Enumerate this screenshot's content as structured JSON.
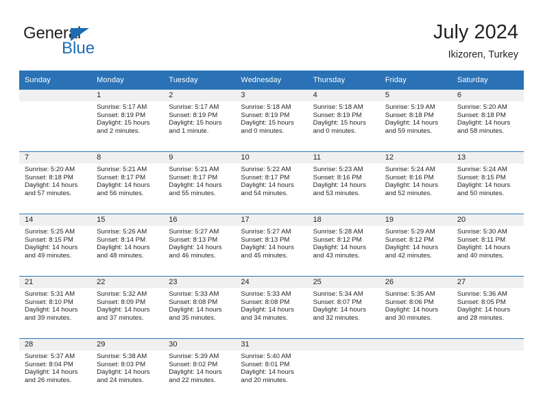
{
  "brand": {
    "name_part1": "General",
    "name_part2": "Blue",
    "accent_color": "#1b6cb2"
  },
  "header": {
    "title": "July 2024",
    "subtitle": "Ikizoren, Turkey"
  },
  "calendar": {
    "header_bg": "#2a72b5",
    "daynum_bg": "#f0f0f0",
    "weekdays": [
      "Sunday",
      "Monday",
      "Tuesday",
      "Wednesday",
      "Thursday",
      "Friday",
      "Saturday"
    ],
    "weeks": [
      [
        {
          "day": "",
          "sunrise": "",
          "sunset": "",
          "daylight_line1": "",
          "daylight_line2": ""
        },
        {
          "day": "1",
          "sunrise": "Sunrise: 5:17 AM",
          "sunset": "Sunset: 8:19 PM",
          "daylight_line1": "Daylight: 15 hours",
          "daylight_line2": "and 2 minutes."
        },
        {
          "day": "2",
          "sunrise": "Sunrise: 5:17 AM",
          "sunset": "Sunset: 8:19 PM",
          "daylight_line1": "Daylight: 15 hours",
          "daylight_line2": "and 1 minute."
        },
        {
          "day": "3",
          "sunrise": "Sunrise: 5:18 AM",
          "sunset": "Sunset: 8:19 PM",
          "daylight_line1": "Daylight: 15 hours",
          "daylight_line2": "and 0 minutes."
        },
        {
          "day": "4",
          "sunrise": "Sunrise: 5:18 AM",
          "sunset": "Sunset: 8:19 PM",
          "daylight_line1": "Daylight: 15 hours",
          "daylight_line2": "and 0 minutes."
        },
        {
          "day": "5",
          "sunrise": "Sunrise: 5:19 AM",
          "sunset": "Sunset: 8:18 PM",
          "daylight_line1": "Daylight: 14 hours",
          "daylight_line2": "and 59 minutes."
        },
        {
          "day": "6",
          "sunrise": "Sunrise: 5:20 AM",
          "sunset": "Sunset: 8:18 PM",
          "daylight_line1": "Daylight: 14 hours",
          "daylight_line2": "and 58 minutes."
        }
      ],
      [
        {
          "day": "7",
          "sunrise": "Sunrise: 5:20 AM",
          "sunset": "Sunset: 8:18 PM",
          "daylight_line1": "Daylight: 14 hours",
          "daylight_line2": "and 57 minutes."
        },
        {
          "day": "8",
          "sunrise": "Sunrise: 5:21 AM",
          "sunset": "Sunset: 8:17 PM",
          "daylight_line1": "Daylight: 14 hours",
          "daylight_line2": "and 56 minutes."
        },
        {
          "day": "9",
          "sunrise": "Sunrise: 5:21 AM",
          "sunset": "Sunset: 8:17 PM",
          "daylight_line1": "Daylight: 14 hours",
          "daylight_line2": "and 55 minutes."
        },
        {
          "day": "10",
          "sunrise": "Sunrise: 5:22 AM",
          "sunset": "Sunset: 8:17 PM",
          "daylight_line1": "Daylight: 14 hours",
          "daylight_line2": "and 54 minutes."
        },
        {
          "day": "11",
          "sunrise": "Sunrise: 5:23 AM",
          "sunset": "Sunset: 8:16 PM",
          "daylight_line1": "Daylight: 14 hours",
          "daylight_line2": "and 53 minutes."
        },
        {
          "day": "12",
          "sunrise": "Sunrise: 5:24 AM",
          "sunset": "Sunset: 8:16 PM",
          "daylight_line1": "Daylight: 14 hours",
          "daylight_line2": "and 52 minutes."
        },
        {
          "day": "13",
          "sunrise": "Sunrise: 5:24 AM",
          "sunset": "Sunset: 8:15 PM",
          "daylight_line1": "Daylight: 14 hours",
          "daylight_line2": "and 50 minutes."
        }
      ],
      [
        {
          "day": "14",
          "sunrise": "Sunrise: 5:25 AM",
          "sunset": "Sunset: 8:15 PM",
          "daylight_line1": "Daylight: 14 hours",
          "daylight_line2": "and 49 minutes."
        },
        {
          "day": "15",
          "sunrise": "Sunrise: 5:26 AM",
          "sunset": "Sunset: 8:14 PM",
          "daylight_line1": "Daylight: 14 hours",
          "daylight_line2": "and 48 minutes."
        },
        {
          "day": "16",
          "sunrise": "Sunrise: 5:27 AM",
          "sunset": "Sunset: 8:13 PM",
          "daylight_line1": "Daylight: 14 hours",
          "daylight_line2": "and 46 minutes."
        },
        {
          "day": "17",
          "sunrise": "Sunrise: 5:27 AM",
          "sunset": "Sunset: 8:13 PM",
          "daylight_line1": "Daylight: 14 hours",
          "daylight_line2": "and 45 minutes."
        },
        {
          "day": "18",
          "sunrise": "Sunrise: 5:28 AM",
          "sunset": "Sunset: 8:12 PM",
          "daylight_line1": "Daylight: 14 hours",
          "daylight_line2": "and 43 minutes."
        },
        {
          "day": "19",
          "sunrise": "Sunrise: 5:29 AM",
          "sunset": "Sunset: 8:12 PM",
          "daylight_line1": "Daylight: 14 hours",
          "daylight_line2": "and 42 minutes."
        },
        {
          "day": "20",
          "sunrise": "Sunrise: 5:30 AM",
          "sunset": "Sunset: 8:11 PM",
          "daylight_line1": "Daylight: 14 hours",
          "daylight_line2": "and 40 minutes."
        }
      ],
      [
        {
          "day": "21",
          "sunrise": "Sunrise: 5:31 AM",
          "sunset": "Sunset: 8:10 PM",
          "daylight_line1": "Daylight: 14 hours",
          "daylight_line2": "and 39 minutes."
        },
        {
          "day": "22",
          "sunrise": "Sunrise: 5:32 AM",
          "sunset": "Sunset: 8:09 PM",
          "daylight_line1": "Daylight: 14 hours",
          "daylight_line2": "and 37 minutes."
        },
        {
          "day": "23",
          "sunrise": "Sunrise: 5:33 AM",
          "sunset": "Sunset: 8:08 PM",
          "daylight_line1": "Daylight: 14 hours",
          "daylight_line2": "and 35 minutes."
        },
        {
          "day": "24",
          "sunrise": "Sunrise: 5:33 AM",
          "sunset": "Sunset: 8:08 PM",
          "daylight_line1": "Daylight: 14 hours",
          "daylight_line2": "and 34 minutes."
        },
        {
          "day": "25",
          "sunrise": "Sunrise: 5:34 AM",
          "sunset": "Sunset: 8:07 PM",
          "daylight_line1": "Daylight: 14 hours",
          "daylight_line2": "and 32 minutes."
        },
        {
          "day": "26",
          "sunrise": "Sunrise: 5:35 AM",
          "sunset": "Sunset: 8:06 PM",
          "daylight_line1": "Daylight: 14 hours",
          "daylight_line2": "and 30 minutes."
        },
        {
          "day": "27",
          "sunrise": "Sunrise: 5:36 AM",
          "sunset": "Sunset: 8:05 PM",
          "daylight_line1": "Daylight: 14 hours",
          "daylight_line2": "and 28 minutes."
        }
      ],
      [
        {
          "day": "28",
          "sunrise": "Sunrise: 5:37 AM",
          "sunset": "Sunset: 8:04 PM",
          "daylight_line1": "Daylight: 14 hours",
          "daylight_line2": "and 26 minutes."
        },
        {
          "day": "29",
          "sunrise": "Sunrise: 5:38 AM",
          "sunset": "Sunset: 8:03 PM",
          "daylight_line1": "Daylight: 14 hours",
          "daylight_line2": "and 24 minutes."
        },
        {
          "day": "30",
          "sunrise": "Sunrise: 5:39 AM",
          "sunset": "Sunset: 8:02 PM",
          "daylight_line1": "Daylight: 14 hours",
          "daylight_line2": "and 22 minutes."
        },
        {
          "day": "31",
          "sunrise": "Sunrise: 5:40 AM",
          "sunset": "Sunset: 8:01 PM",
          "daylight_line1": "Daylight: 14 hours",
          "daylight_line2": "and 20 minutes."
        },
        {
          "day": "",
          "sunrise": "",
          "sunset": "",
          "daylight_line1": "",
          "daylight_line2": ""
        },
        {
          "day": "",
          "sunrise": "",
          "sunset": "",
          "daylight_line1": "",
          "daylight_line2": ""
        },
        {
          "day": "",
          "sunrise": "",
          "sunset": "",
          "daylight_line1": "",
          "daylight_line2": ""
        }
      ]
    ]
  }
}
